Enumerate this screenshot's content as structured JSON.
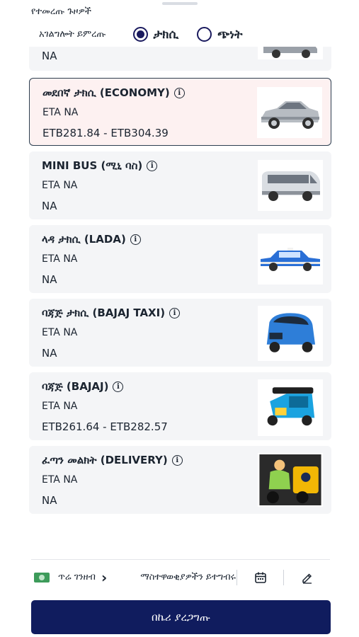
{
  "header": {
    "title": "የተመረጡ ጉዞዎች"
  },
  "service": {
    "label": "አገልግሎት ይምረጡ",
    "options": [
      {
        "label": "ታክሲ",
        "selected": true
      },
      {
        "label": "ጭነት",
        "selected": false
      }
    ]
  },
  "rides": [
    {
      "title": "",
      "eta": "",
      "price": "NA",
      "image": "car-icon",
      "selected": false,
      "partial": true
    },
    {
      "title": "መደበኛ ታክሲ (ECONOMY)",
      "eta": "ETA NA",
      "price": "ETB281.84 - ETB304.39",
      "image": "sedan-icon",
      "selected": true
    },
    {
      "title": "MINI BUS (ሚኒ ባስ)",
      "eta": "ETA NA",
      "price": "NA",
      "image": "minibus-icon",
      "selected": false
    },
    {
      "title": "ላዳ ታክሲ (LADA)",
      "eta": "ETA NA",
      "price": "NA",
      "image": "lada-icon",
      "selected": false
    },
    {
      "title": "ባጃጅ ታክሲ (BAJAJ TAXI)",
      "eta": "ETA NA",
      "price": "NA",
      "image": "bajaj-taxi-icon",
      "selected": false
    },
    {
      "title": "ባጃጅ (BAJAJ)",
      "eta": "ETA NA",
      "price": "ETB261.64 - ETB282.57",
      "image": "tuktuk-icon",
      "selected": false
    },
    {
      "title": "ፈጣን መልክት (DELIVERY)",
      "eta": "ETA NA",
      "price": "NA",
      "image": "delivery-icon",
      "selected": false
    }
  ],
  "bottom": {
    "payment_label": "ጥሬ ገንዘብ",
    "payment_icon": "cash-icon",
    "notes_label": "ማስተዋወቂያዎችን ይተግብሩ",
    "schedule_icon": "calendar-icon",
    "edit_icon": "pencil-icon"
  },
  "confirm_label": "በኬሪ ያረጋግጡ",
  "colors": {
    "primary": "#101c5e",
    "selected_card_bg": "#fdf1f1",
    "card_bg": "#f4f5f7"
  }
}
